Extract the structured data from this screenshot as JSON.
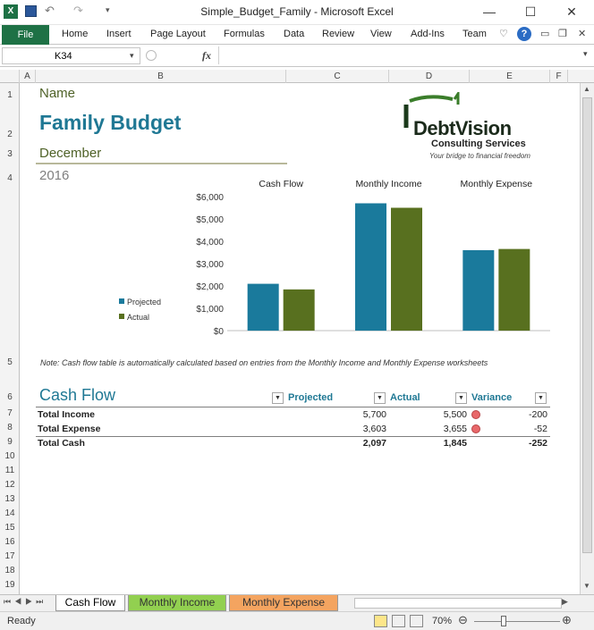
{
  "window": {
    "title": "Simple_Budget_Family  -  Microsoft Excel",
    "minimize": "—",
    "maximize": "☐",
    "close": "✕"
  },
  "ribbon": {
    "tabs": [
      "File",
      "Home",
      "Insert",
      "Page Layout",
      "Formulas",
      "Data",
      "Review",
      "View",
      "Add-Ins",
      "Team"
    ]
  },
  "formula_bar": {
    "name_box": "K34",
    "fx": "fx",
    "value": ""
  },
  "columns": [
    "A",
    "B",
    "C",
    "D",
    "E",
    "F"
  ],
  "rows": [
    "1",
    "2",
    "3",
    "4",
    "5",
    "6",
    "7",
    "8",
    "9",
    "10",
    "11",
    "12",
    "13",
    "14",
    "15",
    "16",
    "17",
    "18",
    "19"
  ],
  "sheet": {
    "name": "Name",
    "title": "Family Budget",
    "month": "December",
    "year": "2016",
    "logo": {
      "brand": "DebtVision",
      "sub": "Consulting Services",
      "tagline": "Your bridge to financial freedom"
    },
    "note": "Note: Cash flow table is automatically calculated based on entries from the Monthly Income and Monthly Expense worksheets",
    "cashflow_title": "Cash Flow",
    "table": {
      "headers": [
        "Projected",
        "Actual",
        "Variance"
      ],
      "rows": [
        {
          "label": "Total Income",
          "projected": "5,700",
          "actual": "5,500",
          "variance": "-200",
          "indicator": true
        },
        {
          "label": "Total Expense",
          "projected": "3,603",
          "actual": "3,655",
          "variance": "-52",
          "indicator": true
        },
        {
          "label": "Total Cash",
          "projected": "2,097",
          "actual": "1,845",
          "variance": "-252",
          "indicator": false
        }
      ]
    }
  },
  "chart_data": {
    "type": "bar",
    "categories": [
      "Cash Flow",
      "Monthly Income",
      "Monthly Expense"
    ],
    "series": [
      {
        "name": "Projected",
        "values": [
          2097,
          5700,
          3603
        ],
        "color": "#1a7a9c"
      },
      {
        "name": "Actual",
        "values": [
          1845,
          5500,
          3655
        ],
        "color": "#58701f"
      }
    ],
    "ylim": [
      0,
      6000
    ],
    "yticks": [
      "$0",
      "$1,000",
      "$2,000",
      "$3,000",
      "$4,000",
      "$5,000",
      "$6,000"
    ],
    "legend": "left",
    "grid": false
  },
  "sheet_tabs": [
    "Cash Flow",
    "Monthly Income",
    "Monthly Expense"
  ],
  "sheet_tab_colors": [
    "#ffffff",
    "#92d050",
    "#f4a460"
  ],
  "status": {
    "ready": "Ready",
    "zoom": "70%"
  }
}
